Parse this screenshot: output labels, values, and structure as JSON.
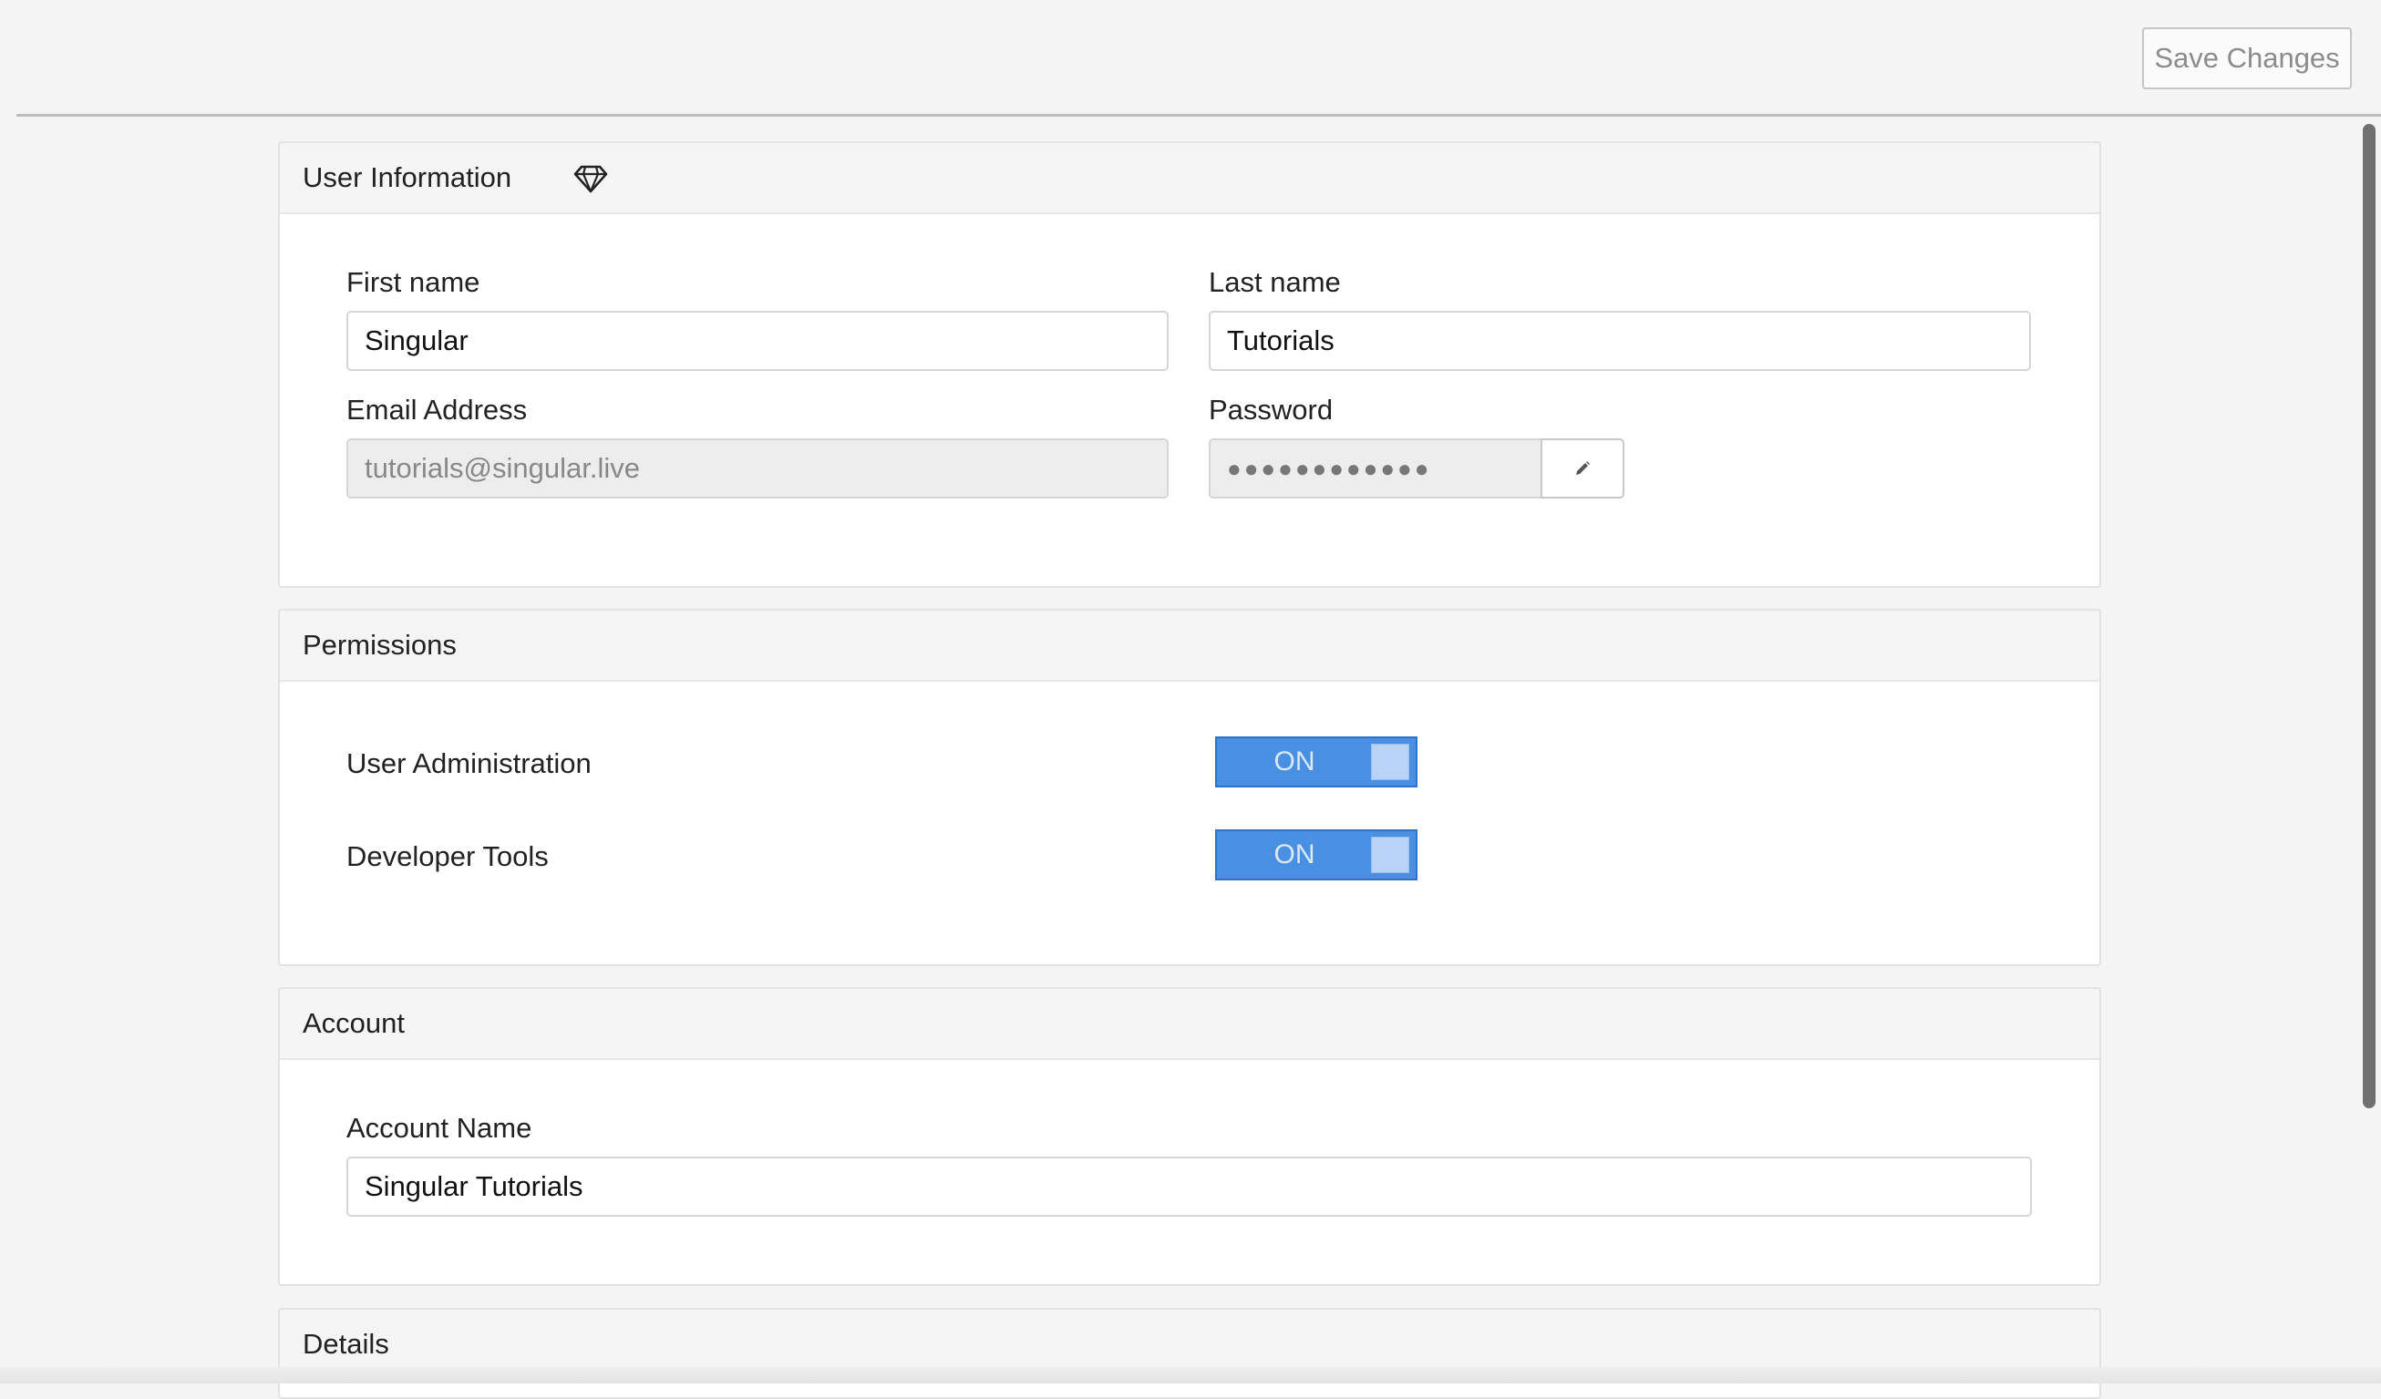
{
  "toolbar": {
    "save_label": "Save Changes"
  },
  "user_info": {
    "title": "User Information",
    "first_name_label": "First name",
    "first_name_value": "Singular",
    "last_name_label": "Last name",
    "last_name_value": "Tutorials",
    "email_label": "Email Address",
    "email_value": "tutorials@singular.live",
    "password_label": "Password",
    "password_value": "●●●●●●●●●●●●"
  },
  "permissions": {
    "title": "Permissions",
    "items": [
      {
        "label": "User Administration",
        "state": "ON"
      },
      {
        "label": "Developer Tools",
        "state": "ON"
      }
    ]
  },
  "account": {
    "title": "Account",
    "name_label": "Account Name",
    "name_value": "Singular Tutorials"
  },
  "details": {
    "title": "Details"
  },
  "colors": {
    "toggle_on": "#4a90e2",
    "page_bg": "#f4f4f4"
  },
  "icons": {
    "header": "gem-icon",
    "password_edit": "pencil-icon"
  }
}
